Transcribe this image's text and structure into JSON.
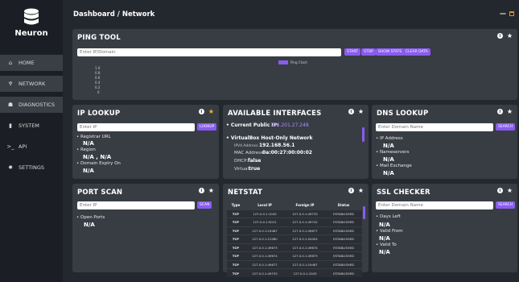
{
  "app": {
    "name": "Neuron"
  },
  "breadcrumb": "Dashboard / Network",
  "sidebar": {
    "items": [
      {
        "label": "HOME",
        "icon": "home-icon",
        "glyph": "⌂"
      },
      {
        "label": "NETWORK",
        "icon": "network-icon",
        "glyph": "♆"
      },
      {
        "label": "DIAGNOSTICS",
        "icon": "diagnostics-icon",
        "glyph": "☗"
      },
      {
        "label": "SYSTEM",
        "icon": "system-icon",
        "glyph": "▮"
      },
      {
        "label": "API",
        "icon": "terminal-icon",
        "glyph": ">_"
      },
      {
        "label": "SETTINGS",
        "icon": "gear-icon",
        "glyph": "✹"
      }
    ]
  },
  "ping": {
    "title": "PING TOOL",
    "placeholder": "Enter IP/Domain",
    "buttons": [
      "START",
      "STOP",
      "SHOW STATS",
      "CLEAR DATA"
    ],
    "chart_legend": "Ping Chart",
    "yticks": [
      "1.0",
      "0.8",
      "0.6",
      "0.4",
      "0.2",
      "0"
    ]
  },
  "iplookup": {
    "title": "IP LOOKUP",
    "placeholder": "Enter IP",
    "button": "LOOKUP",
    "registrar_label": "• Registrar URL",
    "registrar_value": "N/A",
    "region_label": "• Region",
    "region_value": "N/A , N/A",
    "expiry_label": "• Domain Expiry On",
    "expiry_value": "N/A"
  },
  "interfaces": {
    "title": "AVAILABLE INTERFACES",
    "public_ip_label": "• Current Public IP:",
    "public_ip": "106.201.27.248",
    "iface_name": "• VirtualBox Host-Only Network",
    "ipv4_label": "IPV4 Address:",
    "ipv4": "192.168.56.1",
    "mac_label": "MAC Address:",
    "mac": "0a:00:27:00:00:02",
    "dhcp_label": "DHCP:",
    "dhcp": "false",
    "virtual_label": "Virtual:",
    "virtual": "true"
  },
  "dns": {
    "title": "DNS LOOKUP",
    "placeholder": "Enter Domain Name",
    "button": "SEARCH",
    "ip_label": "• IP Address",
    "ip_value": "N/A",
    "ns_label": "• Nameservers",
    "ns_value": "N/A",
    "mx_label": "• Mail Exchange",
    "mx_value": "N/A"
  },
  "portscan": {
    "title": "PORT SCAN",
    "placeholder": "Enter IP",
    "button": "SCAN",
    "open_label": "• Open Ports",
    "open_value": "N/A"
  },
  "netstat": {
    "title": "NETSTAT",
    "headers": [
      "Type",
      "Local IP",
      "Foreign IP",
      "Status"
    ],
    "rows": [
      [
        "TCP",
        "127.0.0.1:1043",
        "127.0.0.1:49733",
        "ESTABLISHED"
      ],
      [
        "TCP",
        "127.0.0.1:5012",
        "127.0.0.1:49742",
        "ESTABLISHED"
      ],
      [
        "TCP",
        "127.0.0.1:19487",
        "127.0.0.1:49677",
        "ESTABLISHED"
      ],
      [
        "TCP",
        "127.0.0.1:21080",
        "127.0.0.1:54454",
        "ESTABLISHED"
      ],
      [
        "TCP",
        "127.0.0.1:49673",
        "127.0.0.1:49674",
        "ESTABLISHED"
      ],
      [
        "TCP",
        "127.0.0.1:49674",
        "127.0.0.1:49673",
        "ESTABLISHED"
      ],
      [
        "TCP",
        "127.0.0.1:49677",
        "127.0.0.1:19487",
        "ESTABLISHED"
      ],
      [
        "TCP",
        "127.0.0.1:49733",
        "127.0.0.1:1043",
        "ESTABLISHED"
      ]
    ]
  },
  "ssl": {
    "title": "SSL CHECKER",
    "placeholder": "Enter Domain Name",
    "button": "SEARCH",
    "days_label": "• Days Left",
    "days_value": "N/A",
    "from_label": "• Valid From",
    "from_value": "N/A",
    "to_label": "• Valid To",
    "to_value": "N/A"
  },
  "colors": {
    "accent": "#8a5cf0",
    "card": "#383d44",
    "bg": "#23272e",
    "sidebar": "#1b1f25",
    "star": "#f3b61f"
  }
}
